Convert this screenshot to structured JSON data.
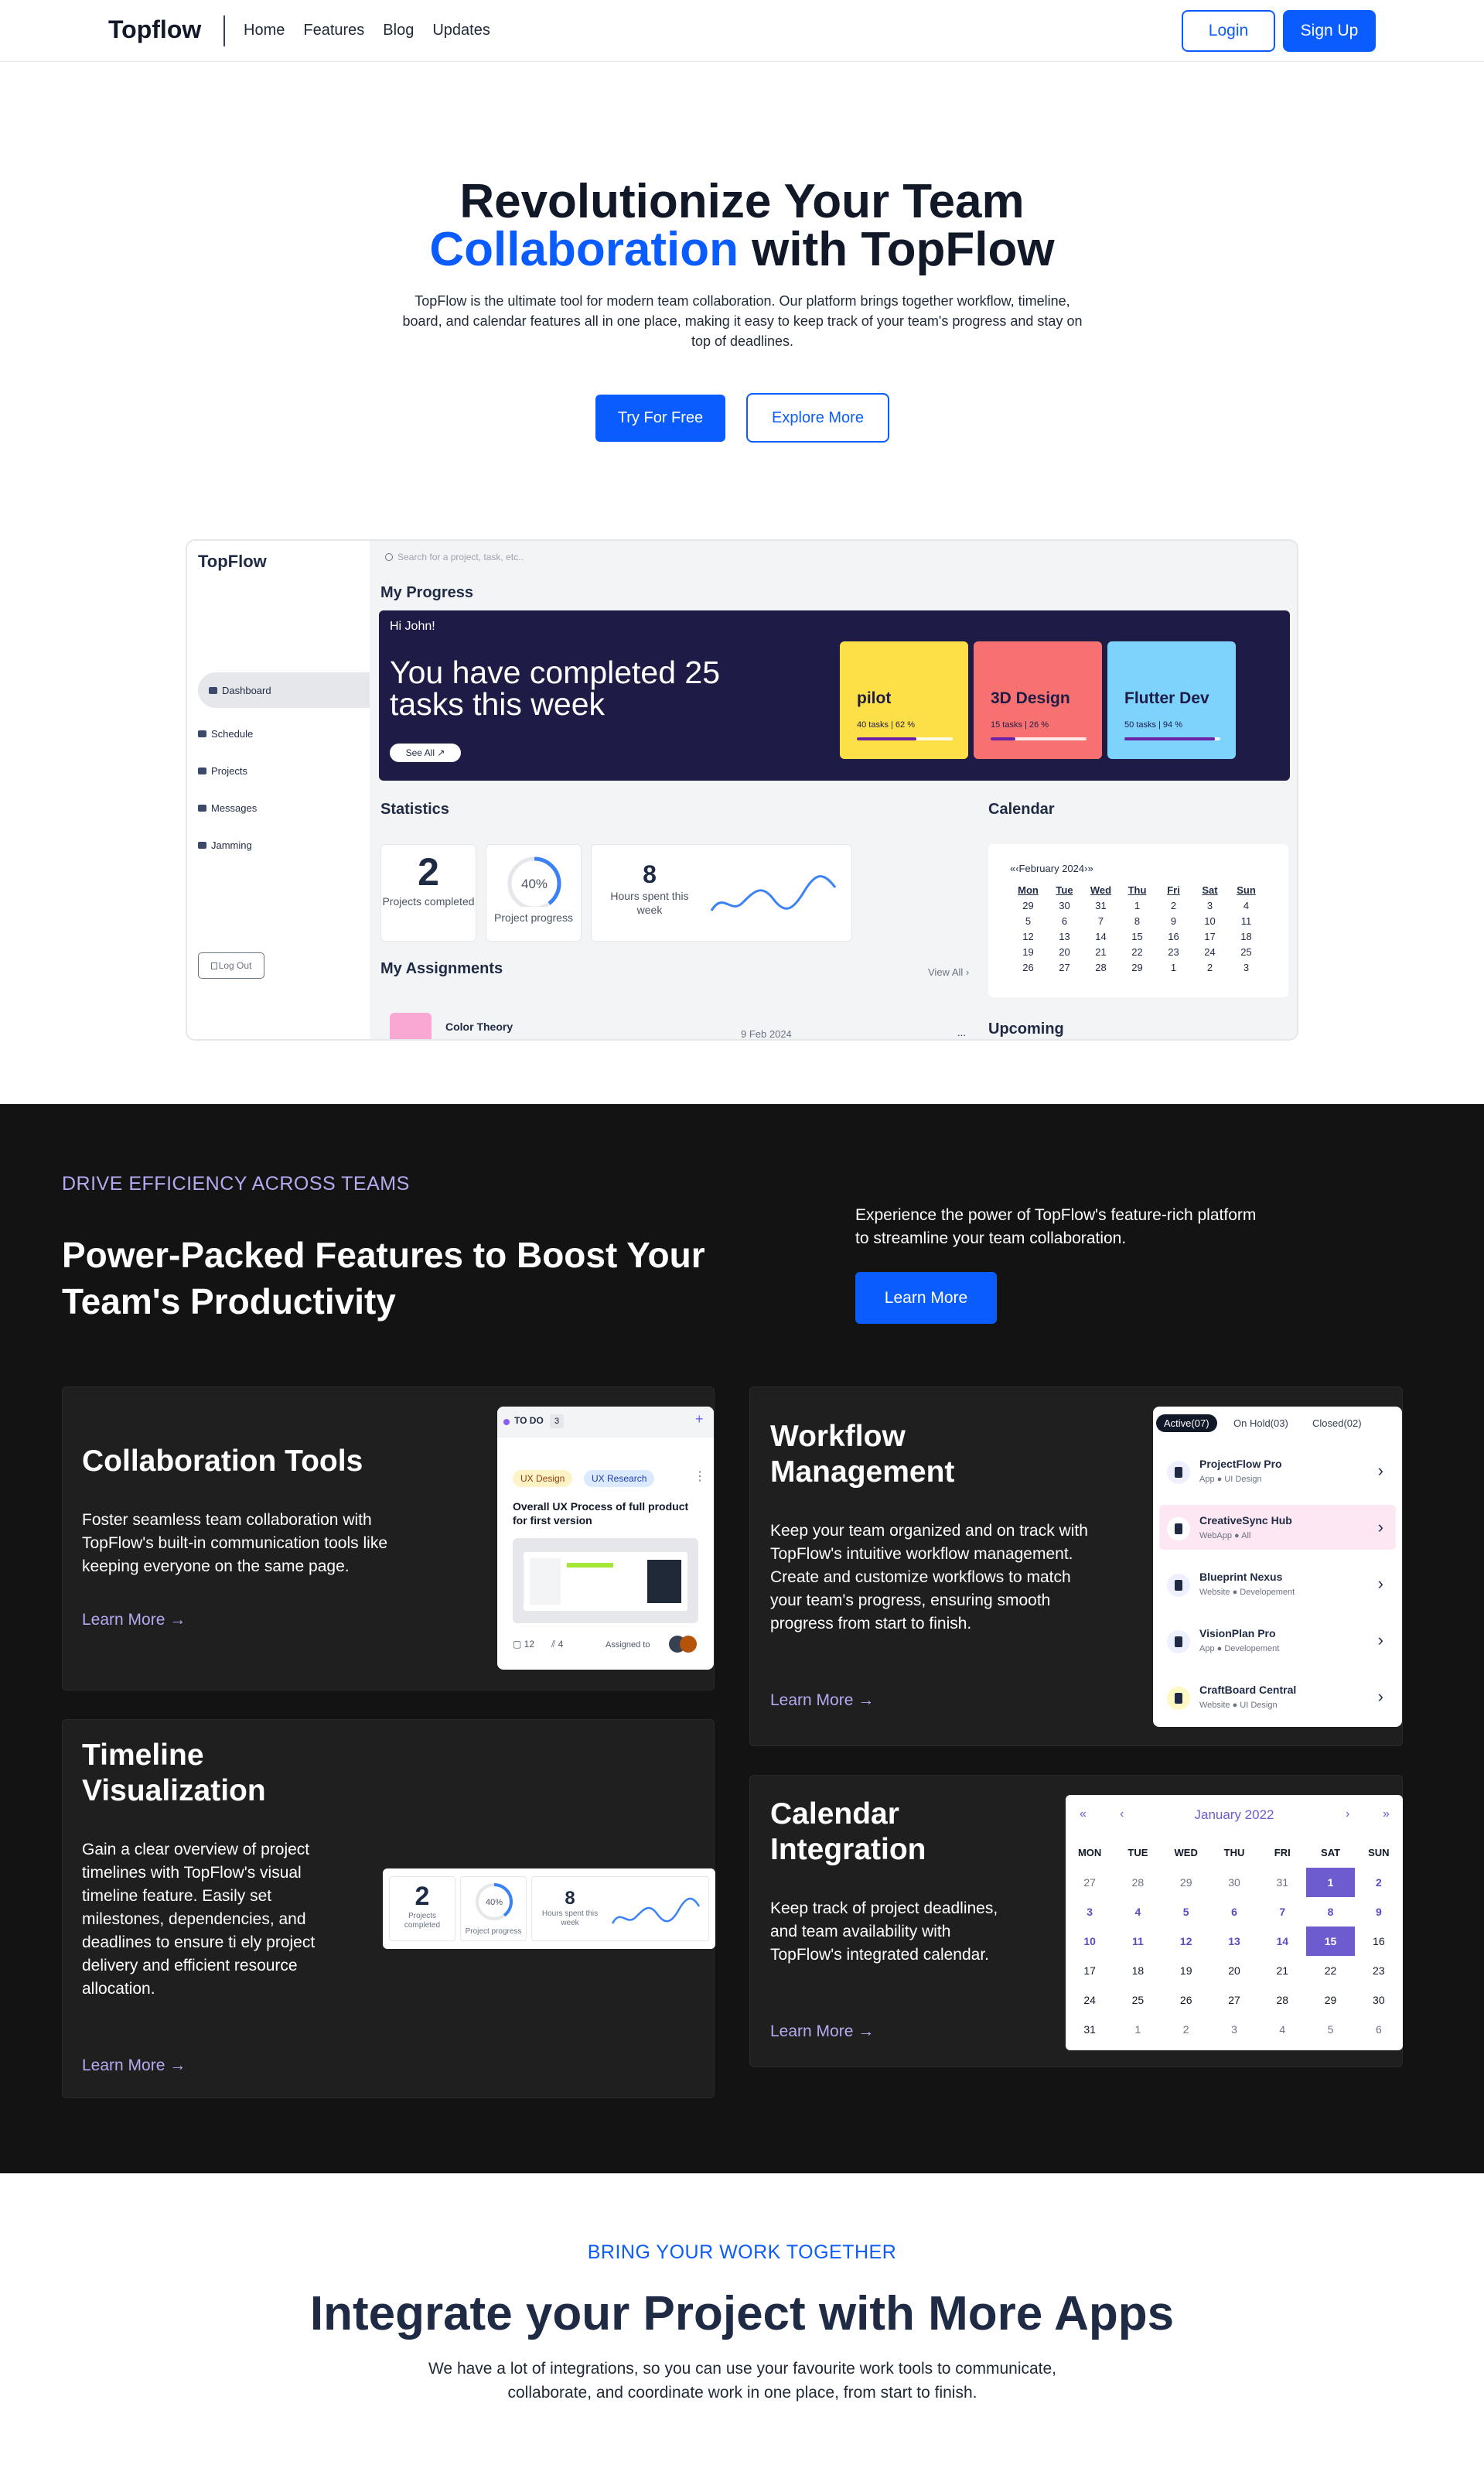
{
  "nav": {
    "brand": "Topflow",
    "links": [
      "Home",
      "Features",
      "Blog",
      "Updates"
    ],
    "login": "Login",
    "signup": "Sign Up"
  },
  "hero": {
    "title_1": "Revolutionize Your Team",
    "title_blue": "Collaboration",
    "title_2": " with TopFlow",
    "desc": "TopFlow is the ultimate tool for modern team collaboration. Our platform brings together workflow, timeline, board, and calendar features all in one place, making it easy to keep track of your team's progress and stay on top of deadlines.",
    "try": "Try For Free",
    "explore": "Explore More"
  },
  "dashboard": {
    "brand": "TopFlow",
    "search_placeholder": "Search for a project, task, etc..",
    "nav": [
      "Dashboard",
      "Schedule",
      "Projects",
      "Messages",
      "Jamming"
    ],
    "logout": "Log Out",
    "my_progress": "My Progress",
    "greeting": "Hi John!",
    "headline": "You have completed 25 tasks this week",
    "see_all": "See All ↗",
    "projects": [
      {
        "name": "pilot",
        "meta": "40 tasks | 62 %",
        "progress": 0.62,
        "color": "#fde047"
      },
      {
        "name": "3D Design",
        "meta": "15 tasks | 26 %",
        "progress": 0.26,
        "color": "#f87171"
      },
      {
        "name": "Flutter Dev",
        "meta": "50 tasks | 94 %",
        "progress": 0.94,
        "color": "#7dd3fc"
      }
    ],
    "statistics": "Statistics",
    "stat_projects_num": "2",
    "stat_projects_label": "Projects completed",
    "stat_progress_val": "40%",
    "stat_progress_label": "Project progress",
    "stat_hours_num": "8",
    "stat_hours_label": "Hours spent this week",
    "calendar": "Calendar",
    "cal_month": "«‹February 2024›»",
    "cal_days": [
      "Mon",
      "Tue",
      "Wed",
      "Thu",
      "Fri",
      "Sat",
      "Sun"
    ],
    "cal_cells": [
      "29",
      "30",
      "31",
      "1",
      "2",
      "3",
      "4",
      "5",
      "6",
      "7",
      "8",
      "9",
      "10",
      "11",
      "12",
      "13",
      "14",
      "15",
      "16",
      "17",
      "18",
      "19",
      "20",
      "21",
      "22",
      "23",
      "24",
      "25",
      "26",
      "27",
      "28",
      "29",
      "1",
      "2",
      "3"
    ],
    "assignments": "My Assignments",
    "view_all": "View All ›",
    "assign_name": "Color Theory",
    "assign_date": "9 Feb 2024",
    "assign_more": "...",
    "upcoming": "Upcoming"
  },
  "features": {
    "kicker": "DRIVE EFFICIENCY ACROSS TEAMS",
    "title": "Power-Packed Features to Boost Your Team's Productivity",
    "intro": "Experience the power of TopFlow's feature-rich platform to streamline your team collaboration.",
    "learn_more": "Learn More",
    "collab": {
      "title": "Collaboration Tools",
      "desc": "Foster seamless team collaboration with TopFlow's built-in communication tools like keeping everyone on the same page.",
      "link": "Learn More →",
      "todo_label": "TO DO",
      "todo_count": "3",
      "tag1": "UX Design",
      "tag2": "UX Research",
      "task": "Overall UX Process of full product for first version",
      "comments": "12",
      "attachments": "4",
      "assigned": "Assigned to"
    },
    "workflow": {
      "title": "Workflow Management",
      "desc": "Keep your team organized and on track with TopFlow's intuitive workflow management. Create and customize workflows to match your team's progress, ensuring smooth progress from start to finish.",
      "link": "Learn More →",
      "tabs": [
        "Active(07)",
        "On Hold(03)",
        "Closed(02)"
      ],
      "items": [
        {
          "name": "ProjectFlow Pro",
          "meta": "App ● UI Design"
        },
        {
          "name": "CreativeSync Hub",
          "meta": "WebApp ● All"
        },
        {
          "name": "Blueprint Nexus",
          "meta": "Website ● Developement"
        },
        {
          "name": "VisionPlan Pro",
          "meta": "App ● Developement"
        },
        {
          "name": "CraftBoard Central",
          "meta": "Website ● UI Design"
        }
      ]
    },
    "timeline": {
      "title": "Timeline Visualization",
      "desc": "Gain a clear overview of project timelines with TopFlow's visual timeline feature. Easily set milestones, dependencies, and deadlines to ensure ti ely project delivery and efficient resource allocation.",
      "link": "Learn More →",
      "num1": "2",
      "label1": "Projects completed",
      "pct": "40%",
      "label2": "Project progress",
      "num3": "8",
      "label3": "Hours spent this week"
    },
    "calendar": {
      "title": "Calendar Integration",
      "desc": "Keep track of project deadlines, and team availability with TopFlow's integrated calendar.",
      "link": "Learn More →",
      "month": "January 2022",
      "nav_first": "«",
      "nav_prev": "‹",
      "nav_next": "›",
      "nav_last": "»",
      "days": [
        "MON",
        "TUE",
        "WED",
        "THU",
        "FRI",
        "SAT",
        "SUN"
      ],
      "cells": [
        "27",
        "28",
        "29",
        "30",
        "31",
        "1",
        "2",
        "3",
        "4",
        "5",
        "6",
        "7",
        "8",
        "9",
        "10",
        "11",
        "12",
        "13",
        "14",
        "15",
        "16",
        "17",
        "18",
        "19",
        "20",
        "21",
        "22",
        "23",
        "24",
        "25",
        "26",
        "27",
        "28",
        "29",
        "30",
        "31",
        "1",
        "2",
        "3",
        "4",
        "5",
        "6"
      ]
    }
  },
  "integrate": {
    "kicker": "BRING YOUR WORK TOGETHER",
    "title": "Integrate your Project with More Apps",
    "desc": "We have a lot of integrations, so you can use your favourite work tools to communicate, collaborate, and coordinate work in one place, from start to finish."
  }
}
